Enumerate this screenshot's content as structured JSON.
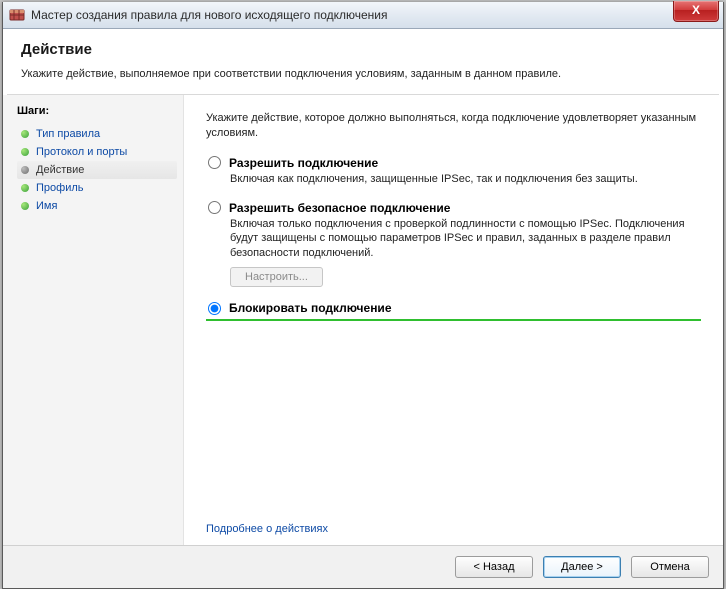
{
  "window": {
    "title": "Мастер создания правила для нового исходящего подключения",
    "close_label": "X"
  },
  "header": {
    "title": "Действие",
    "subtitle": "Укажите действие, выполняемое при соответствии подключения условиям, заданным в данном правиле."
  },
  "steps": {
    "title": "Шаги:",
    "items": [
      {
        "label": "Тип правила",
        "current": false
      },
      {
        "label": "Протокол и порты",
        "current": false
      },
      {
        "label": "Действие",
        "current": true
      },
      {
        "label": "Профиль",
        "current": false
      },
      {
        "label": "Имя",
        "current": false
      }
    ]
  },
  "content": {
    "intro": "Укажите действие, которое должно выполняться, когда подключение удовлетворяет указанным условиям.",
    "options": [
      {
        "title": "Разрешить подключение",
        "desc": "Включая как подключения, защищенные IPSec, так и подключения без защиты.",
        "selected": false
      },
      {
        "title": "Разрешить безопасное подключение",
        "desc": "Включая только подключения с проверкой подлинности с помощью IPSec. Подключения будут защищены с помощью параметров IPSec и правил, заданных в разделе правил безопасности подключений.",
        "selected": false
      },
      {
        "title": "Блокировать подключение",
        "desc": "",
        "selected": true
      }
    ],
    "configure_button": "Настроить...",
    "learn_more": "Подробнее о действиях"
  },
  "footer": {
    "back": "< Назад",
    "next": "Далее >",
    "cancel": "Отмена"
  }
}
